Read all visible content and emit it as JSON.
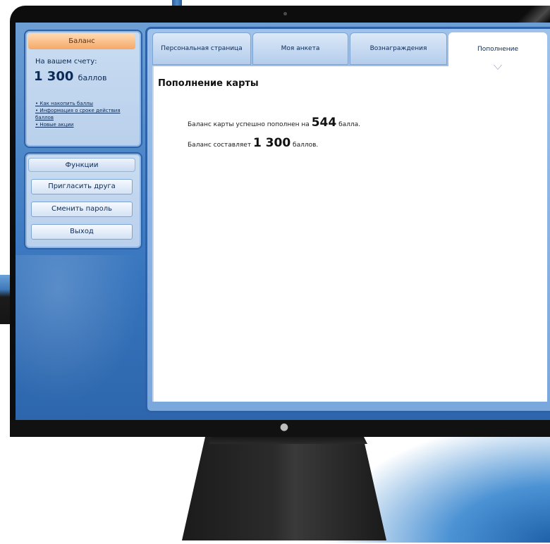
{
  "balance": {
    "header": "Баланс",
    "caption": "На вашем счету:",
    "amount": "1 300",
    "unit": "баллов",
    "links": [
      "Как накопить баллы",
      "Информация о сроке действия баллов",
      "Новые акции"
    ]
  },
  "functions": {
    "header": "Функции",
    "invite": "Пригласить друга",
    "change_password": "Сменить пароль",
    "logout": "Выход"
  },
  "tabs": [
    {
      "label": "Персональная страница",
      "active": false
    },
    {
      "label": "Моя анкета",
      "active": false
    },
    {
      "label": "Вознаграждения",
      "active": false
    },
    {
      "label": "Пополнение",
      "active": true
    }
  ],
  "content": {
    "title": "Пополнение карты",
    "line1_prefix": "Баланс карты успешно пополнен на",
    "line1_value": "544",
    "line1_suffix": "балла.",
    "line2_prefix": "Баланс составляет",
    "line2_value": "1 300",
    "line2_suffix": "баллов."
  },
  "icons": {
    "monitor_logo": "apple-logo-icon"
  },
  "colors": {
    "accent_orange": "#f5a868",
    "frame_blue": "#2d62a8",
    "screen_blue": "#4c86c8"
  }
}
